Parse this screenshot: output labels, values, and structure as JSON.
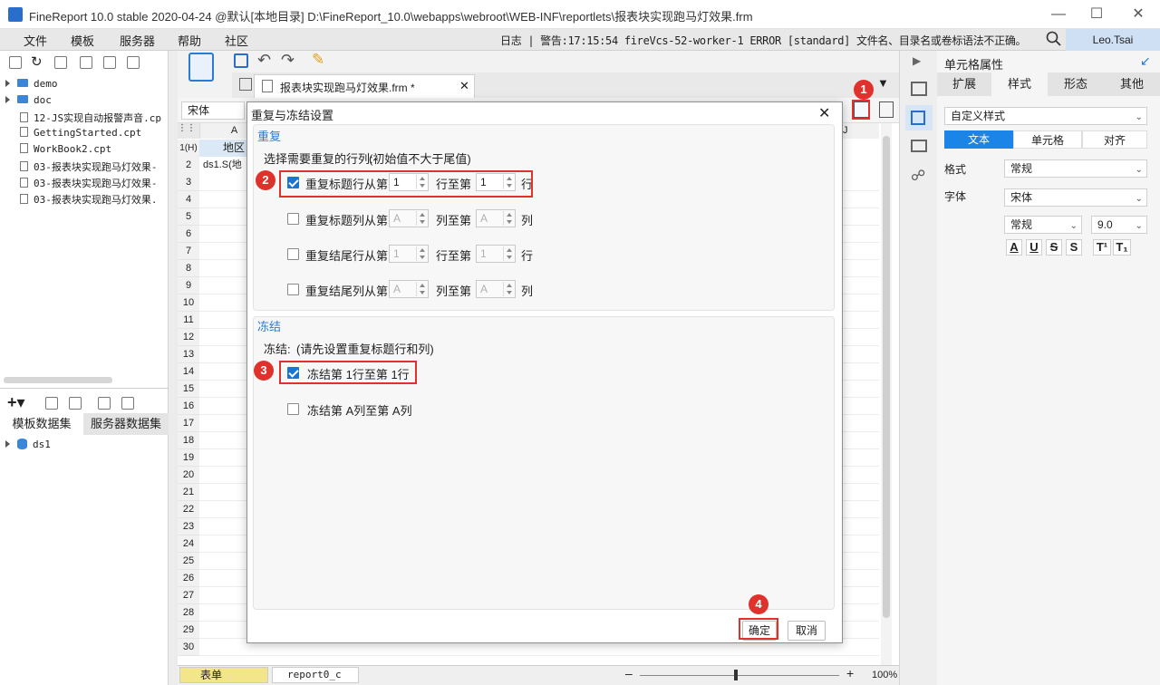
{
  "window": {
    "title": "FineReport 10.0 stable 2020-04-24 @默认[本地目录]    D:\\FineReport_10.0\\webapps\\webroot\\WEB-INF\\reportlets\\报表块实现跑马灯效果.frm"
  },
  "menu": [
    "文件",
    "模板",
    "服务器",
    "帮助",
    "社区"
  ],
  "log": {
    "text": "日志 | 警告:17:15:54 fireVcs-52-worker-1 ERROR [standard] 文件名、目录名或卷标语法不正确。"
  },
  "user": "Leo.Tsai",
  "tree": [
    {
      "label": "demo",
      "type": "folder"
    },
    {
      "label": "doc",
      "type": "folder"
    },
    {
      "label": "12-JS实现自动报警声音.cp",
      "type": "file"
    },
    {
      "label": "GettingStarted.cpt",
      "type": "file"
    },
    {
      "label": "WorkBook2.cpt",
      "type": "file"
    },
    {
      "label": "03-报表块实现跑马灯效果-",
      "type": "file"
    },
    {
      "label": "03-报表块实现跑马灯效果-",
      "type": "file"
    },
    {
      "label": "03-报表块实现跑马灯效果.",
      "type": "file"
    }
  ],
  "datasets": {
    "tab1": "模板数据集",
    "tab2": "服务器数据集",
    "item": "ds1"
  },
  "doc_tab": "报表块实现跑马灯效果.frm *",
  "font_name": "宋体",
  "grid": {
    "col_a": "A",
    "col_j": "J",
    "row1_hdr": "1(H)",
    "cell_b1": "地区",
    "cell_b2": "ds1.S(地",
    "rows": [
      "3",
      "4",
      "5",
      "6",
      "7",
      "8",
      "9",
      "10",
      "11",
      "12",
      "13",
      "14",
      "15",
      "16",
      "17",
      "18",
      "19",
      "20",
      "21",
      "22",
      "23",
      "24",
      "25",
      "26",
      "27",
      "28",
      "29",
      "30"
    ]
  },
  "sheets": {
    "tab1": "表单",
    "tab2": "report0_c"
  },
  "zoom": "100%",
  "right_panel": {
    "title": "单元格属性",
    "tabs": [
      "扩展",
      "样式",
      "形态",
      "其他"
    ],
    "style_select": "自定义样式",
    "subtabs": [
      "文本",
      "单元格",
      "对齐"
    ],
    "format_label": "格式",
    "format_value": "常规",
    "font_label": "字体",
    "font_value": "宋体",
    "font_style": "常规",
    "font_size": "9.0",
    "fmt_buttons": [
      "A",
      "U",
      "S",
      "S",
      "T¹",
      "T₁"
    ]
  },
  "dialog": {
    "title": "重复与冻结设置",
    "repeat_section": "重复",
    "repeat_prompt": "选择需要重复的行列:",
    "repeat_hint": "(初始值不大于尾值)",
    "rows": [
      {
        "label": "重复标题行从第",
        "from": "1",
        "mid": "行至第",
        "to": "1",
        "unit": "行",
        "checked": true
      },
      {
        "label": "重复标题列从第",
        "from": "A",
        "mid": "列至第",
        "to": "A",
        "unit": "列",
        "checked": false
      },
      {
        "label": "重复结尾行从第",
        "from": "1",
        "mid": "行至第",
        "to": "1",
        "unit": "行",
        "checked": false
      },
      {
        "label": "重复结尾列从第",
        "from": "A",
        "mid": "列至第",
        "to": "A",
        "unit": "列",
        "checked": false
      }
    ],
    "freeze_section": "冻结",
    "freeze_prompt": "冻结:",
    "freeze_hint": "(请先设置重复标题行和列)",
    "freeze_rows": "冻结第 1行至第 1行",
    "freeze_cols": "冻结第 A列至第 A列",
    "ok": "确定",
    "cancel": "取消"
  },
  "badges": [
    "1",
    "2",
    "3",
    "4"
  ]
}
